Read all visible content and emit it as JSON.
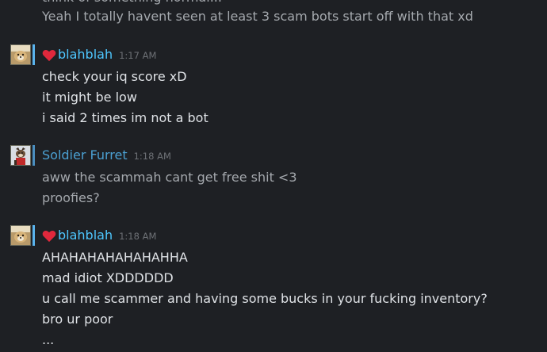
{
  "colors": {
    "background": "#1e2024",
    "text": "#dfe2e6",
    "text_muted": "#a4a8ad",
    "sender_online": "#4ec7ff",
    "sender_friend": "#4ba0d2",
    "timestamp": "#6e7176",
    "heart": "#e0283c"
  },
  "earlier": {
    "clipped_line": "think of something normal...",
    "line": "Yeah I totally havent seen at least 3 scam bots start off with that xd"
  },
  "groups": [
    {
      "sender": "blahblah",
      "time": "1:17 AM",
      "icon": "heart-icon",
      "messages": [
        "check your iq score xD",
        "it might be low",
        "i said 2 times im not a bot"
      ]
    },
    {
      "sender": "Soldier Furret",
      "time": "1:18 AM",
      "messages": [
        "aww the scammah cant get free shit <3",
        "proofies?"
      ]
    },
    {
      "sender": "blahblah",
      "time": "1:18 AM",
      "icon": "heart-icon",
      "messages": [
        "AHAHAHAHAHAHAHHA",
        "mad idiot XDDDDDD",
        "u call me scammer and having some bucks in your fucking inventory?",
        "bro ur poor",
        "..."
      ]
    }
  ]
}
